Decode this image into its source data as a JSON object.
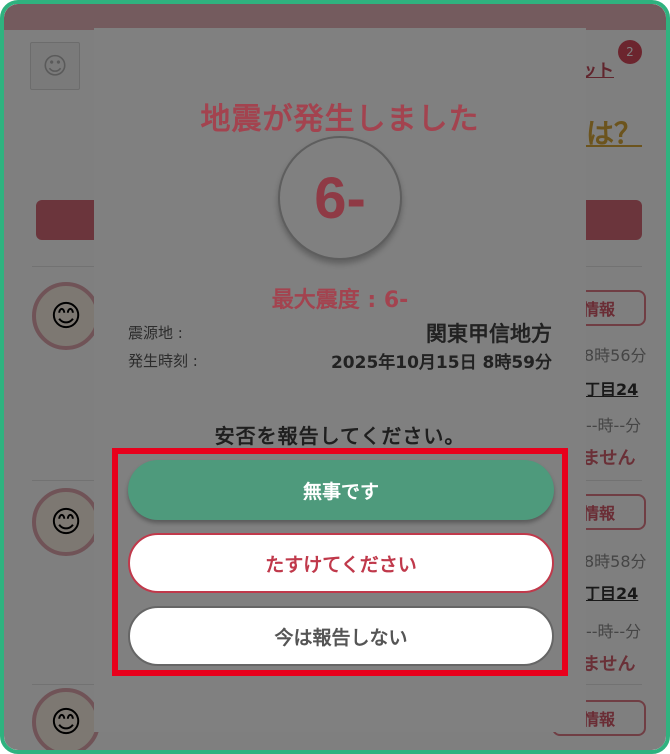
{
  "background": {
    "notify_link": "ット",
    "badge_count": "2",
    "question_text": "は？",
    "user_icon": "user-icon",
    "entries": [
      {
        "avatar": "😊",
        "button": "情報",
        "time": "8時56分",
        "address": "丁目24",
        "status_time": "--時--分",
        "status": "ません"
      },
      {
        "avatar": "😊",
        "button": "情報",
        "time": "8時58分",
        "address": "丁目24",
        "status_time": "--時--分",
        "status": "ません"
      },
      {
        "avatar": "😊",
        "button": "情報"
      }
    ]
  },
  "modal": {
    "title": "地震が発生しました",
    "intensity": "6-",
    "max_intensity_label": "最大震度 : 6-",
    "epicenter_label": "震源地 :",
    "epicenter_value": "関東甲信地方",
    "time_label": "発生時刻 :",
    "time_value": "2025年10月15日 8時59分",
    "prompt": "安否を報告してください。"
  },
  "buttons": {
    "safe": "無事です",
    "help": "たすけてください",
    "skip": "今は報告しない"
  },
  "colors": {
    "frame": "#2fb27f",
    "highlight": "#e8001c",
    "safe_button": "#4e9a7c",
    "help_text": "#c0394b",
    "title": "#a3434f"
  }
}
